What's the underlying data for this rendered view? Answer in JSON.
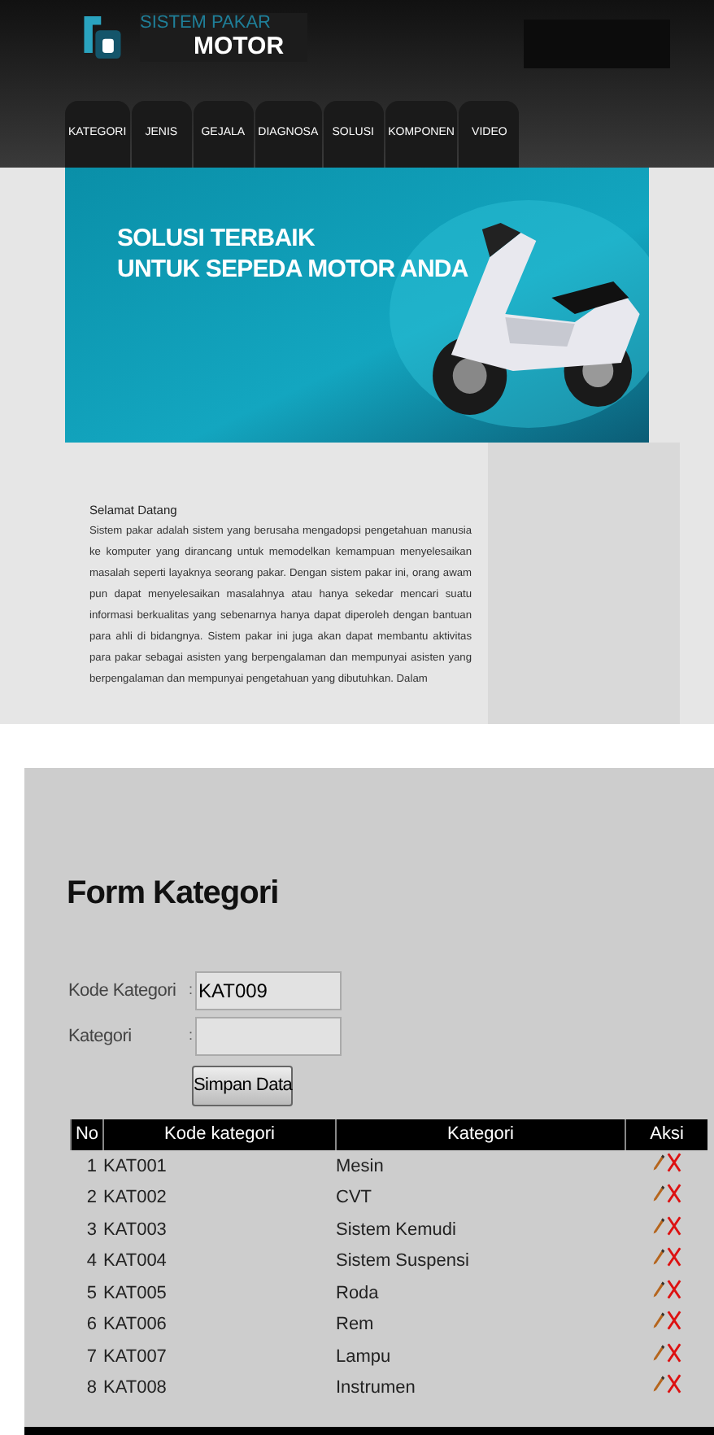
{
  "header": {
    "title_top": "SISTEM PAKAR",
    "title_main": "MOTOR"
  },
  "nav": [
    {
      "label": "KATEGORI"
    },
    {
      "label": "JENIS"
    },
    {
      "label": "GEJALA"
    },
    {
      "label": "DIAGNOSA"
    },
    {
      "label": "SOLUSI"
    },
    {
      "label": "KOMPONEN"
    },
    {
      "label": "VIDEO"
    }
  ],
  "banner": {
    "line_1": "SOLUSI TERBAIK",
    "line_2": "UNTUK SEPEDA MOTOR ANDA"
  },
  "welcome": {
    "heading": "Selamat Datang",
    "body": "Sistem pakar adalah sistem yang berusaha mengadopsi pengetahuan manusia ke komputer yang dirancang untuk memodelkan kemampuan menyelesaikan masalah seperti layaknya seorang pakar. Dengan sistem pakar ini, orang awam pun dapat menyelesaikan masalahnya atau hanya sekedar mencari suatu informasi berkualitas yang sebenarnya hanya dapat diperoleh dengan bantuan para ahli di bidangnya. Sistem pakar ini juga akan dapat membantu aktivitas para pakar sebagai asisten yang berpengalaman dan mempunyai asisten yang berpengalaman dan mempunyai pengetahuan yang dibutuhkan. Dalam"
  },
  "form": {
    "title": "Form Kategori",
    "fields": [
      {
        "label": "Kode Kategori",
        "separator": ":",
        "value": "KAT009"
      },
      {
        "label": "Kategori",
        "separator": ":"
      }
    ],
    "submit": "Simpan Data"
  },
  "table": {
    "columns": [
      "No",
      "Kode kategori",
      "Kategori",
      "Aksi"
    ],
    "rows": [
      [
        "1",
        "KAT001",
        "Mesin"
      ],
      [
        "2",
        "KAT002",
        "CVT"
      ],
      [
        "3",
        "KAT003",
        "Sistem Kemudi"
      ],
      [
        "4",
        "KAT004",
        "Sistem Suspensi"
      ],
      [
        "5",
        "KAT005",
        "Roda"
      ],
      [
        "6",
        "KAT006",
        "Rem"
      ],
      [
        "7",
        "KAT007",
        "Lampu"
      ],
      [
        "8",
        "KAT008",
        "Instrumen"
      ]
    ]
  }
}
